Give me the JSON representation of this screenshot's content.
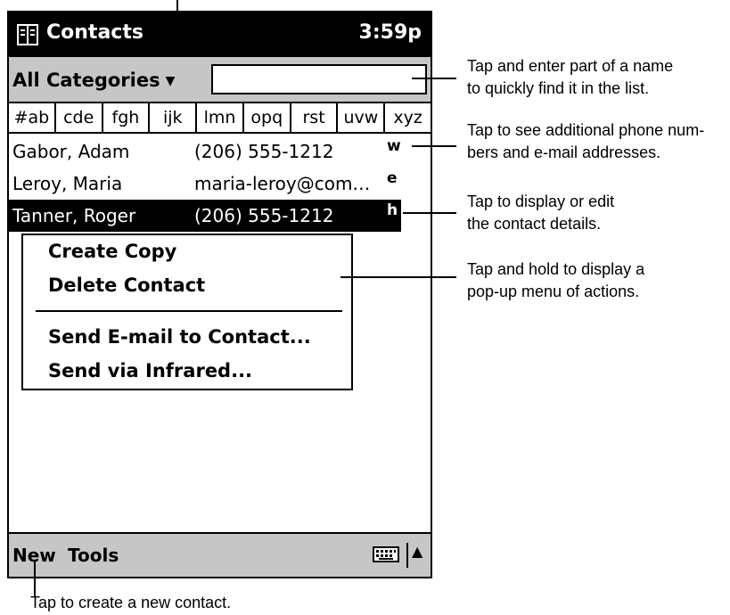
{
  "device": {
    "title": "Contacts",
    "time": "3:59p",
    "category": "All Categories",
    "search_value": "",
    "tabs": [
      "#ab",
      "cde",
      "fgh",
      "ijk",
      "lmn",
      "opq",
      "rst",
      "uvw",
      "xyz"
    ],
    "contacts": [
      {
        "name": "Gabor, Adam",
        "detail": "(206) 555-1212",
        "tag": "w",
        "selected": false
      },
      {
        "name": "Leroy, Maria",
        "detail": "maria-leroy@com…",
        "tag": "e",
        "selected": false
      },
      {
        "name": "Tanner, Roger",
        "detail": "(206) 555-1212",
        "tag": "h",
        "selected": true
      }
    ],
    "popup_menu": {
      "items": [
        "Create Copy",
        "Delete Contact"
      ],
      "items_after_separator": [
        "Send E-mail to Contact...",
        "Send via Infrared..."
      ]
    },
    "command_bar": {
      "new_label": "New",
      "tools_label": "Tools",
      "keyboard_icon": "keyboard-icon",
      "up_icon": "up-arrow-icon"
    }
  },
  "callouts": {
    "find": "Tap and enter part of a name to quickly find it in the list.",
    "find_lines": [
      "Tap and enter part of a name",
      "to quickly find it in the list."
    ],
    "phone_lines": [
      "Tap to see additional phone num-",
      "bers and e-mail addresses."
    ],
    "details_lines": [
      "Tap to display or edit",
      "the contact details."
    ],
    "menu_lines": [
      "Tap and hold to display a",
      "pop-up menu of actions."
    ],
    "new_line": "Tap to create a new contact."
  },
  "colors": {
    "title_bar": "#000000",
    "tool_bar": "#c6c6c6",
    "selection": "#000000"
  }
}
